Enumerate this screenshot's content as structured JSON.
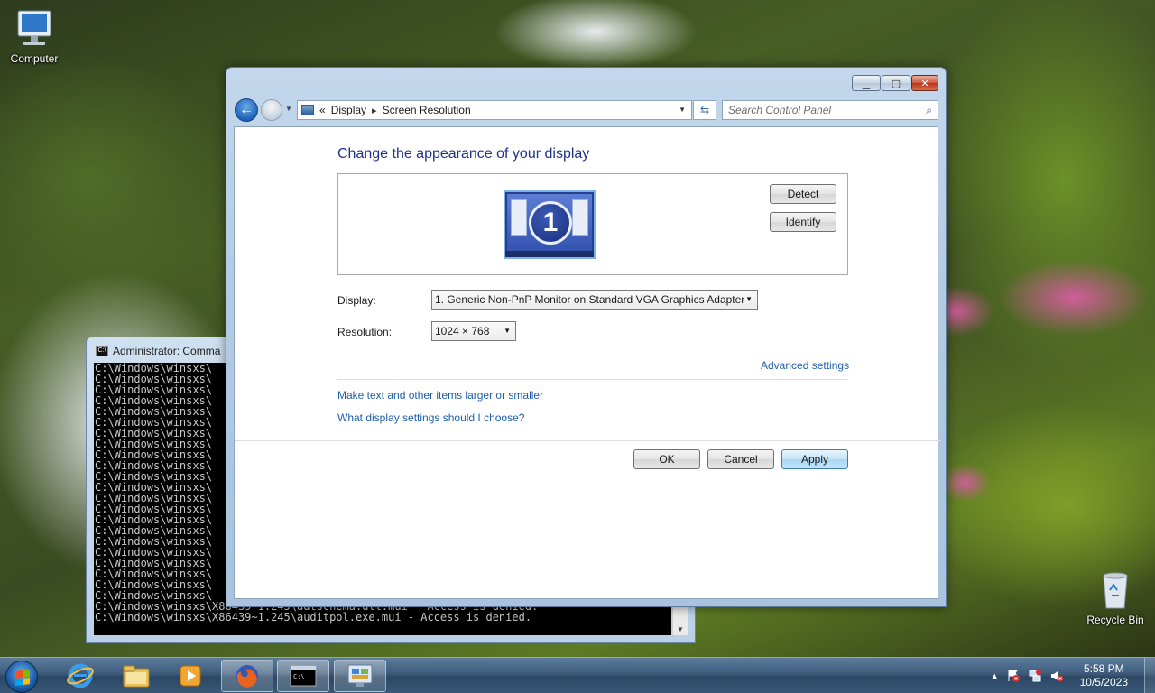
{
  "desktop": {
    "computer_label": "Computer",
    "recycle_label": "Recycle Bin"
  },
  "cmd": {
    "title": "Administrator:  Comma",
    "lines": [
      "C:\\Windows\\winsxs\\",
      "C:\\Windows\\winsxs\\",
      "C:\\Windows\\winsxs\\",
      "C:\\Windows\\winsxs\\",
      "C:\\Windows\\winsxs\\",
      "C:\\Windows\\winsxs\\",
      "C:\\Windows\\winsxs\\",
      "C:\\Windows\\winsxs\\",
      "C:\\Windows\\winsxs\\",
      "C:\\Windows\\winsxs\\",
      "C:\\Windows\\winsxs\\",
      "C:\\Windows\\winsxs\\",
      "C:\\Windows\\winsxs\\",
      "C:\\Windows\\winsxs\\",
      "C:\\Windows\\winsxs\\",
      "C:\\Windows\\winsxs\\",
      "C:\\Windows\\winsxs\\",
      "C:\\Windows\\winsxs\\",
      "C:\\Windows\\winsxs\\",
      "C:\\Windows\\winsxs\\",
      "C:\\Windows\\winsxs\\",
      "C:\\Windows\\winsxs\\",
      "C:\\Windows\\winsxs\\X86439~1.245\\adtschema.dll.mui - Access is denied.",
      "C:\\Windows\\winsxs\\X86439~1.245\\auditpol.exe.mui - Access is denied."
    ]
  },
  "window": {
    "breadcrumb": [
      "Display",
      "Screen Resolution"
    ],
    "breadcrumb_prefix": "«",
    "search_placeholder": "Search Control Panel",
    "heading": "Change the appearance of your display",
    "monitor_number": "1",
    "detect_label": "Detect",
    "identify_label": "Identify",
    "display_label": "Display:",
    "display_value": "1. Generic Non-PnP Monitor on Standard VGA Graphics Adapter",
    "resolution_label": "Resolution:",
    "resolution_value": "1024 × 768",
    "advanced_link": "Advanced settings",
    "text_size_link": "Make text and other items larger or smaller",
    "help_link": "What display settings should I choose?",
    "ok_label": "OK",
    "cancel_label": "Cancel",
    "apply_label": "Apply"
  },
  "taskbar": {
    "time": "5:58 PM",
    "date": "10/5/2023",
    "items": [
      "internet-explorer",
      "windows-explorer",
      "media-player",
      "firefox",
      "command-prompt",
      "control-panel"
    ]
  },
  "colors": {
    "heading": "#1e3287",
    "link": "#1d5fae",
    "taskbar": "#3e5b7a"
  }
}
